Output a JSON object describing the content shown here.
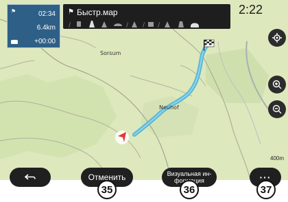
{
  "route_panel": {
    "time": "02:34",
    "distance": "6.4km",
    "delay": "+00:00"
  },
  "banner": {
    "title": "Быстр.мар"
  },
  "status": {
    "clock": "2:22"
  },
  "map": {
    "labels": [
      "Sorsum",
      "Neuhof"
    ],
    "scale": "400m"
  },
  "buttons": {
    "back_icon": "return-arrow-icon",
    "cancel_label": "Отменить",
    "visual_info_label": "Визуальная ин-\nформация",
    "more_label": "···"
  },
  "callouts": [
    "35",
    "36",
    "37"
  ],
  "colors": {
    "route": "#5bb8d6",
    "panel": "#2e5f86",
    "button": "#202020",
    "vehicle": "#e53935"
  }
}
